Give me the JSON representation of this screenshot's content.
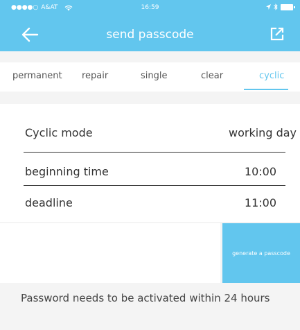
{
  "status_bar": {
    "signal": "●●●●○",
    "carrier": "A&AT",
    "time": "16:59"
  },
  "nav": {
    "title": "send passcode"
  },
  "tabs": [
    {
      "label": "permanent"
    },
    {
      "label": "repair"
    },
    {
      "label": "single"
    },
    {
      "label": "clear"
    },
    {
      "label": "cyclic",
      "active": true
    }
  ],
  "form": {
    "cyclic_mode_label": "Cyclic mode",
    "cyclic_mode_value": "working day",
    "beginning_time_label": "beginning time",
    "beginning_time_value": "10:00",
    "deadline_label": "deadline",
    "deadline_value": "11:00"
  },
  "actions": {
    "generate_label": "generate a passcode"
  },
  "notice": "Password needs to be activated within 24 hours",
  "colors": {
    "accent": "#62c6ee",
    "background": "#f4f4f4"
  }
}
